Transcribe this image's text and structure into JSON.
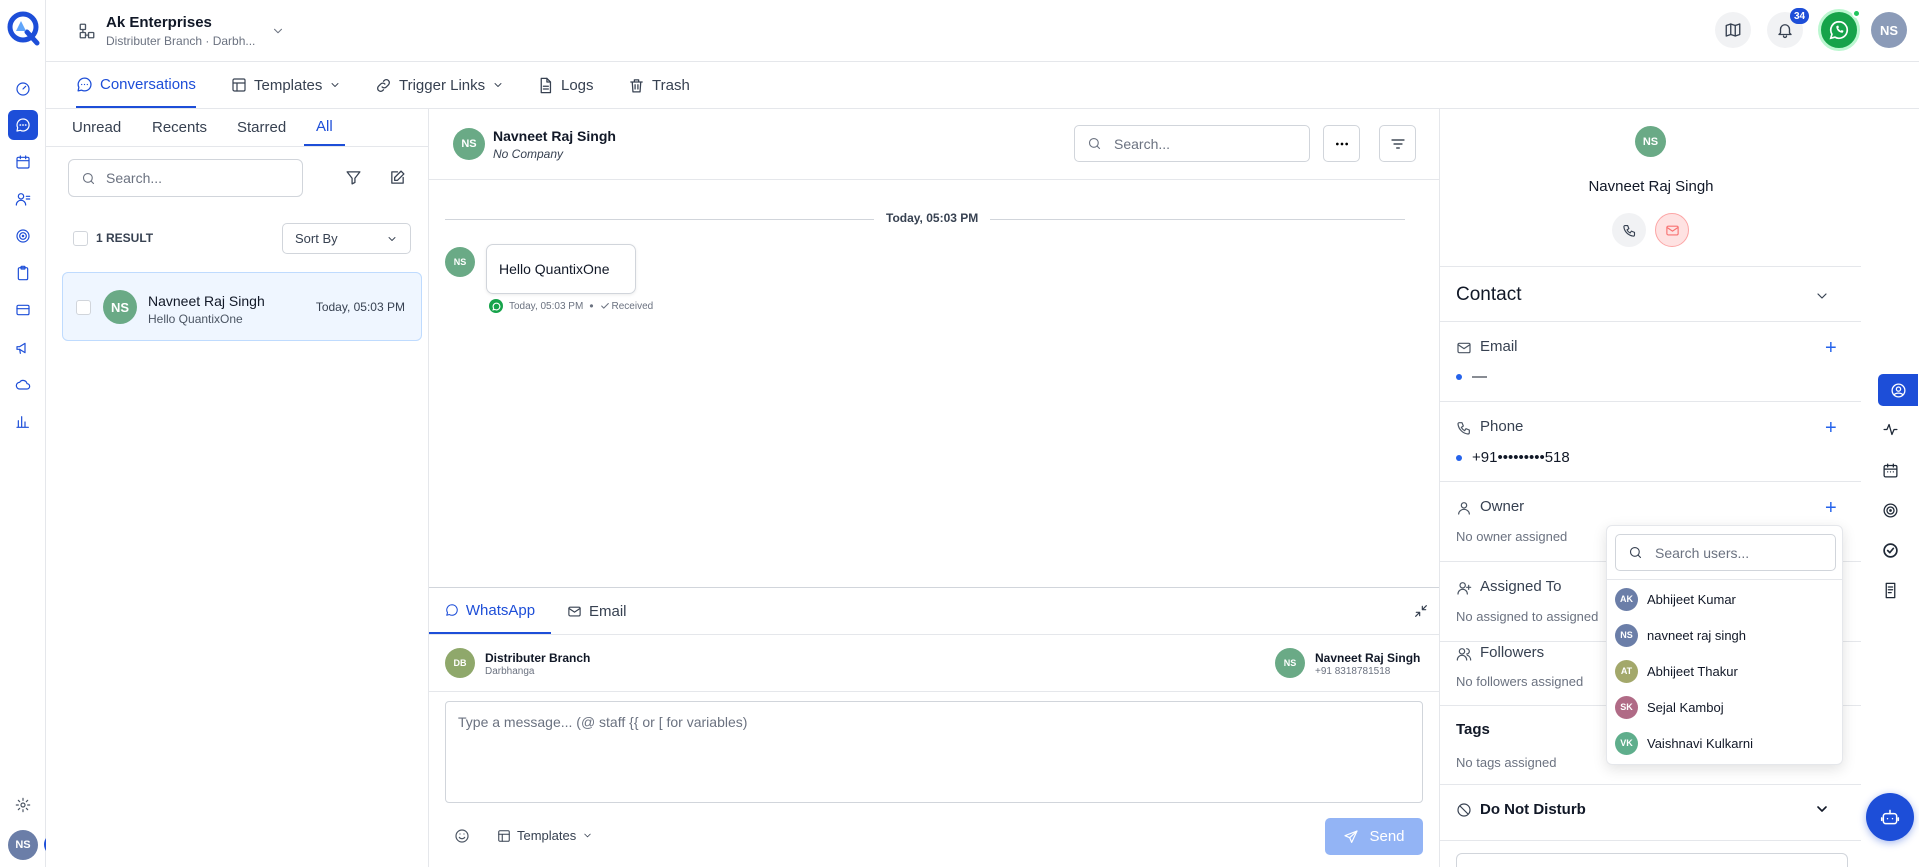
{
  "app": {
    "org_name": "Ak Enterprises",
    "branch": "Distributer Branch · Darbh...",
    "user_initials": "NS",
    "notification_count": "34"
  },
  "nav": {
    "tabs": [
      {
        "label": "Conversations",
        "icon": "chat-bubble-icon"
      },
      {
        "label": "Templates",
        "icon": "template-icon"
      },
      {
        "label": "Trigger Links",
        "icon": "link-icon"
      },
      {
        "label": "Logs",
        "icon": "document-icon"
      },
      {
        "label": "Trash",
        "icon": "trash-icon"
      }
    ]
  },
  "list": {
    "filters": [
      "Unread",
      "Recents",
      "Starred",
      "All"
    ],
    "active_filter": "All",
    "search_placeholder": "Search...",
    "result_count": "1 RESULT",
    "sort_label": "Sort By",
    "items": [
      {
        "initials": "NS",
        "name": "Navneet Raj Singh",
        "preview": "Hello QuantixOne",
        "time": "Today, 05:03 PM"
      }
    ]
  },
  "chat": {
    "contact_initials": "NS",
    "contact_name": "Navneet Raj Singh",
    "contact_company": "No Company",
    "search_placeholder": "Search...",
    "date_divider": "Today, 05:03 PM",
    "messages": [
      {
        "initials": "NS",
        "text": "Hello QuantixOne",
        "time": "Today, 05:03 PM",
        "status": "Received",
        "channel": "whatsapp"
      }
    ]
  },
  "composer": {
    "tabs": [
      "WhatsApp",
      "Email"
    ],
    "active_tab": "WhatsApp",
    "from_initials": "DB",
    "from_name": "Distributer Branch",
    "from_sub": "Darbhanga",
    "to_initials": "NS",
    "to_name": "Navneet Raj Singh",
    "to_phone": "+91 8318781518",
    "placeholder": "Type a message... (@ staff  {{ or [ for variables)",
    "templates_label": "Templates",
    "send_label": "Send"
  },
  "contact_panel": {
    "initials": "NS",
    "name": "Navneet Raj Singh",
    "section_title": "Contact",
    "email_label": "Email",
    "email_value": "—",
    "phone_label": "Phone",
    "phone_value": "+91•••••••••518",
    "owner_label": "Owner",
    "owner_value": "No owner assigned",
    "assigned_label": "Assigned To",
    "assigned_value": "No assigned to assigned",
    "followers_label": "Followers",
    "followers_value": "No followers assigned",
    "tags_label": "Tags",
    "tags_value": "No tags assigned",
    "dnd_label": "Do Not Disturb"
  },
  "user_dropdown": {
    "search_placeholder": "Search users...",
    "users": [
      {
        "initials": "AK",
        "name": "Abhijeet Kumar",
        "color": "#6b7ea8"
      },
      {
        "initials": "NS",
        "name": "navneet raj singh",
        "color": "#6b7ea8"
      },
      {
        "initials": "AT",
        "name": "Abhijeet Thakur",
        "color": "#a3a86b"
      },
      {
        "initials": "SK",
        "name": "Sejal Kamboj",
        "color": "#b06b86"
      },
      {
        "initials": "VK",
        "name": "Vaishnavi Kulkarni",
        "color": "#5fae8c"
      }
    ]
  },
  "colors": {
    "primary": "#1d4ed8",
    "whatsapp": "#16a34a",
    "avatar_green": "#6aaa86",
    "avatar_olive": "#8fa86b"
  }
}
